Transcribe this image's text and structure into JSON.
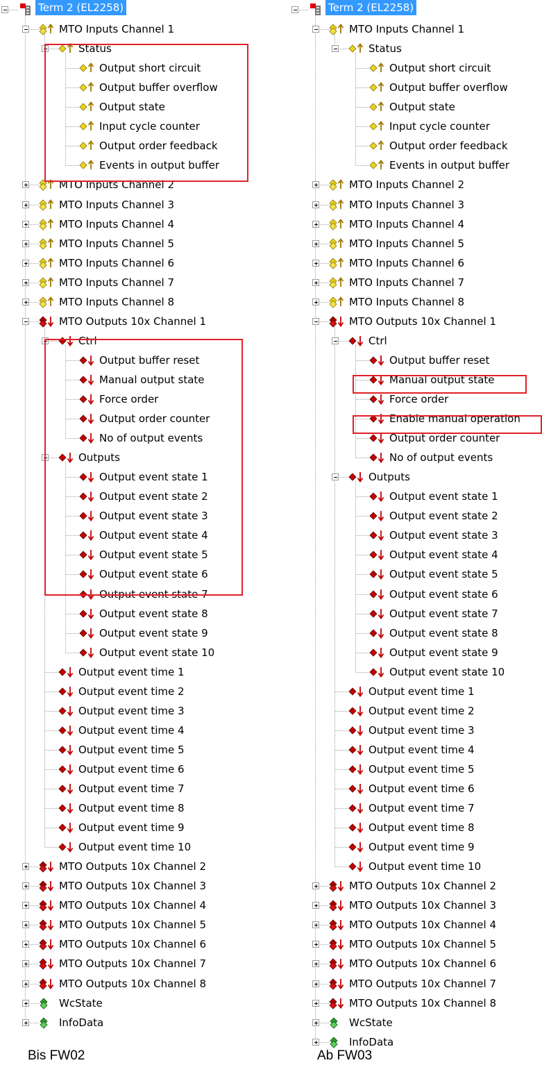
{
  "colors": {
    "highlight_box": "#e0202a",
    "selection": "#3399ff",
    "input_icon": "#e8d31e",
    "output_icon": "#b30000",
    "status_icon": "#2ca02c"
  },
  "left_panel": {
    "caption": "Bis FW02",
    "tree": [
      {
        "label": "Term 2 (EL2258)",
        "level": 0,
        "expander": "minus",
        "icon": "terminal-icon",
        "selected": true
      },
      {
        "label": "MTO Inputs Channel 1",
        "level": 1,
        "expander": "minus",
        "icon": "input-group-icon"
      },
      {
        "label": "Status",
        "level": 2,
        "expander": "minus",
        "icon": "input-var-icon"
      },
      {
        "label": "Output short circuit",
        "level": 3,
        "icon": "input-var-icon"
      },
      {
        "label": "Output buffer overflow",
        "level": 3,
        "icon": "input-var-icon"
      },
      {
        "label": "Output state",
        "level": 3,
        "icon": "input-var-icon"
      },
      {
        "label": "Input cycle counter",
        "level": 3,
        "icon": "input-var-icon"
      },
      {
        "label": "Output order feedback",
        "level": 3,
        "icon": "input-var-icon"
      },
      {
        "label": "Events in output buffer",
        "level": 3,
        "icon": "input-var-icon"
      },
      {
        "label": "MTO Inputs Channel 2",
        "level": 1,
        "expander": "plus",
        "icon": "input-group-icon"
      },
      {
        "label": "MTO Inputs Channel 3",
        "level": 1,
        "expander": "plus",
        "icon": "input-group-icon"
      },
      {
        "label": "MTO Inputs Channel 4",
        "level": 1,
        "expander": "plus",
        "icon": "input-group-icon"
      },
      {
        "label": "MTO Inputs Channel 5",
        "level": 1,
        "expander": "plus",
        "icon": "input-group-icon"
      },
      {
        "label": "MTO Inputs Channel 6",
        "level": 1,
        "expander": "plus",
        "icon": "input-group-icon"
      },
      {
        "label": "MTO Inputs Channel 7",
        "level": 1,
        "expander": "plus",
        "icon": "input-group-icon"
      },
      {
        "label": "MTO Inputs Channel 8",
        "level": 1,
        "expander": "plus",
        "icon": "input-group-icon"
      },
      {
        "label": "MTO Outputs 10x Channel 1",
        "level": 1,
        "expander": "minus",
        "icon": "output-group-icon"
      },
      {
        "label": "Ctrl",
        "level": 2,
        "expander": "minus",
        "icon": "output-var-icon"
      },
      {
        "label": "Output buffer reset",
        "level": 3,
        "icon": "output-var-icon"
      },
      {
        "label": "Manual output state",
        "level": 3,
        "icon": "output-var-icon"
      },
      {
        "label": "Force order",
        "level": 3,
        "icon": "output-var-icon"
      },
      {
        "label": "Output order counter",
        "level": 3,
        "icon": "output-var-icon"
      },
      {
        "label": "No of output events",
        "level": 3,
        "icon": "output-var-icon"
      },
      {
        "label": "Outputs",
        "level": 2,
        "expander": "minus",
        "icon": "output-var-icon"
      },
      {
        "label": "Output event state 1",
        "level": 3,
        "icon": "output-var-icon"
      },
      {
        "label": "Output event state 2",
        "level": 3,
        "icon": "output-var-icon"
      },
      {
        "label": "Output event state 3",
        "level": 3,
        "icon": "output-var-icon"
      },
      {
        "label": "Output event state 4",
        "level": 3,
        "icon": "output-var-icon"
      },
      {
        "label": "Output event state 5",
        "level": 3,
        "icon": "output-var-icon"
      },
      {
        "label": "Output event state 6",
        "level": 3,
        "icon": "output-var-icon"
      },
      {
        "label": "Output event state 7",
        "level": 3,
        "icon": "output-var-icon"
      },
      {
        "label": "Output event state 8",
        "level": 3,
        "icon": "output-var-icon"
      },
      {
        "label": "Output event state 9",
        "level": 3,
        "icon": "output-var-icon"
      },
      {
        "label": "Output event state 10",
        "level": 3,
        "icon": "output-var-icon"
      },
      {
        "label": "Output event time 1",
        "level": 2,
        "icon": "output-var-icon"
      },
      {
        "label": "Output event time 2",
        "level": 2,
        "icon": "output-var-icon"
      },
      {
        "label": "Output event time 3",
        "level": 2,
        "icon": "output-var-icon"
      },
      {
        "label": "Output event time 4",
        "level": 2,
        "icon": "output-var-icon"
      },
      {
        "label": "Output event time 5",
        "level": 2,
        "icon": "output-var-icon"
      },
      {
        "label": "Output event time 6",
        "level": 2,
        "icon": "output-var-icon"
      },
      {
        "label": "Output event time 7",
        "level": 2,
        "icon": "output-var-icon"
      },
      {
        "label": "Output event time 8",
        "level": 2,
        "icon": "output-var-icon"
      },
      {
        "label": "Output event time 9",
        "level": 2,
        "icon": "output-var-icon"
      },
      {
        "label": "Output event time 10",
        "level": 2,
        "icon": "output-var-icon"
      },
      {
        "label": "MTO Outputs 10x Channel 2",
        "level": 1,
        "expander": "plus",
        "icon": "output-group-icon"
      },
      {
        "label": "MTO Outputs 10x Channel 3",
        "level": 1,
        "expander": "plus",
        "icon": "output-group-icon"
      },
      {
        "label": "MTO Outputs 10x Channel 4",
        "level": 1,
        "expander": "plus",
        "icon": "output-group-icon"
      },
      {
        "label": "MTO Outputs 10x Channel 5",
        "level": 1,
        "expander": "plus",
        "icon": "output-group-icon"
      },
      {
        "label": "MTO Outputs 10x Channel 6",
        "level": 1,
        "expander": "plus",
        "icon": "output-group-icon"
      },
      {
        "label": "MTO Outputs 10x Channel 7",
        "level": 1,
        "expander": "plus",
        "icon": "output-group-icon"
      },
      {
        "label": "MTO Outputs 10x Channel 8",
        "level": 1,
        "expander": "plus",
        "icon": "output-group-icon"
      },
      {
        "label": "WcState",
        "level": 1,
        "expander": "plus",
        "icon": "status-icon"
      },
      {
        "label": "InfoData",
        "level": 1,
        "expander": "plus",
        "icon": "status-icon"
      }
    ]
  },
  "right_panel": {
    "caption": "Ab FW03",
    "tree": [
      {
        "label": "Term 2 (EL2258)",
        "level": 0,
        "expander": "minus",
        "icon": "terminal-icon",
        "selected": true
      },
      {
        "label": "MTO Inputs Channel 1",
        "level": 1,
        "expander": "minus",
        "icon": "input-group-icon"
      },
      {
        "label": "Status",
        "level": 2,
        "expander": "minus",
        "icon": "input-var-icon"
      },
      {
        "label": "Output short circuit",
        "level": 3,
        "icon": "input-var-icon"
      },
      {
        "label": "Output buffer overflow",
        "level": 3,
        "icon": "input-var-icon"
      },
      {
        "label": "Output state",
        "level": 3,
        "icon": "input-var-icon"
      },
      {
        "label": "Input cycle counter",
        "level": 3,
        "icon": "input-var-icon"
      },
      {
        "label": "Output order feedback",
        "level": 3,
        "icon": "input-var-icon"
      },
      {
        "label": "Events in output buffer",
        "level": 3,
        "icon": "input-var-icon"
      },
      {
        "label": "MTO Inputs Channel 2",
        "level": 1,
        "expander": "plus",
        "icon": "input-group-icon"
      },
      {
        "label": "MTO Inputs Channel 3",
        "level": 1,
        "expander": "plus",
        "icon": "input-group-icon"
      },
      {
        "label": "MTO Inputs Channel 4",
        "level": 1,
        "expander": "plus",
        "icon": "input-group-icon"
      },
      {
        "label": "MTO Inputs Channel 5",
        "level": 1,
        "expander": "plus",
        "icon": "input-group-icon"
      },
      {
        "label": "MTO Inputs Channel 6",
        "level": 1,
        "expander": "plus",
        "icon": "input-group-icon"
      },
      {
        "label": "MTO Inputs Channel 7",
        "level": 1,
        "expander": "plus",
        "icon": "input-group-icon"
      },
      {
        "label": "MTO Inputs Channel 8",
        "level": 1,
        "expander": "plus",
        "icon": "input-group-icon"
      },
      {
        "label": "MTO Outputs 10x Channel 1",
        "level": 1,
        "expander": "minus",
        "icon": "output-group-icon"
      },
      {
        "label": "Ctrl",
        "level": 2,
        "expander": "minus",
        "icon": "output-var-icon"
      },
      {
        "label": "Output buffer reset",
        "level": 3,
        "icon": "output-var-icon"
      },
      {
        "label": "Manual output state",
        "level": 3,
        "icon": "output-var-icon"
      },
      {
        "label": "Force order",
        "level": 3,
        "icon": "output-var-icon"
      },
      {
        "label": "Enable manual operation",
        "level": 3,
        "icon": "output-var-icon"
      },
      {
        "label": "Output order counter",
        "level": 3,
        "icon": "output-var-icon"
      },
      {
        "label": "No of output events",
        "level": 3,
        "icon": "output-var-icon"
      },
      {
        "label": "Outputs",
        "level": 2,
        "expander": "minus",
        "icon": "output-var-icon"
      },
      {
        "label": "Output event state 1",
        "level": 3,
        "icon": "output-var-icon"
      },
      {
        "label": "Output event state 2",
        "level": 3,
        "icon": "output-var-icon"
      },
      {
        "label": "Output event state 3",
        "level": 3,
        "icon": "output-var-icon"
      },
      {
        "label": "Output event state 4",
        "level": 3,
        "icon": "output-var-icon"
      },
      {
        "label": "Output event state 5",
        "level": 3,
        "icon": "output-var-icon"
      },
      {
        "label": "Output event state 6",
        "level": 3,
        "icon": "output-var-icon"
      },
      {
        "label": "Output event state 7",
        "level": 3,
        "icon": "output-var-icon"
      },
      {
        "label": "Output event state 8",
        "level": 3,
        "icon": "output-var-icon"
      },
      {
        "label": "Output event state 9",
        "level": 3,
        "icon": "output-var-icon"
      },
      {
        "label": "Output event state 10",
        "level": 3,
        "icon": "output-var-icon"
      },
      {
        "label": "Output event time 1",
        "level": 2,
        "icon": "output-var-icon"
      },
      {
        "label": "Output event time 2",
        "level": 2,
        "icon": "output-var-icon"
      },
      {
        "label": "Output event time 3",
        "level": 2,
        "icon": "output-var-icon"
      },
      {
        "label": "Output event time 4",
        "level": 2,
        "icon": "output-var-icon"
      },
      {
        "label": "Output event time 5",
        "level": 2,
        "icon": "output-var-icon"
      },
      {
        "label": "Output event time 6",
        "level": 2,
        "icon": "output-var-icon"
      },
      {
        "label": "Output event time 7",
        "level": 2,
        "icon": "output-var-icon"
      },
      {
        "label": "Output event time 8",
        "level": 2,
        "icon": "output-var-icon"
      },
      {
        "label": "Output event time 9",
        "level": 2,
        "icon": "output-var-icon"
      },
      {
        "label": "Output event time 10",
        "level": 2,
        "icon": "output-var-icon"
      },
      {
        "label": "MTO Outputs 10x Channel 2",
        "level": 1,
        "expander": "plus",
        "icon": "output-group-icon"
      },
      {
        "label": "MTO Outputs 10x Channel 3",
        "level": 1,
        "expander": "plus",
        "icon": "output-group-icon"
      },
      {
        "label": "MTO Outputs 10x Channel 4",
        "level": 1,
        "expander": "plus",
        "icon": "output-group-icon"
      },
      {
        "label": "MTO Outputs 10x Channel 5",
        "level": 1,
        "expander": "plus",
        "icon": "output-group-icon"
      },
      {
        "label": "MTO Outputs 10x Channel 6",
        "level": 1,
        "expander": "plus",
        "icon": "output-group-icon"
      },
      {
        "label": "MTO Outputs 10x Channel 7",
        "level": 1,
        "expander": "plus",
        "icon": "output-group-icon"
      },
      {
        "label": "MTO Outputs 10x Channel 8",
        "level": 1,
        "expander": "plus",
        "icon": "output-group-icon"
      },
      {
        "label": "WcState",
        "level": 1,
        "expander": "plus",
        "icon": "status-icon"
      },
      {
        "label": "InfoData",
        "level": 1,
        "expander": "plus",
        "icon": "status-icon"
      }
    ]
  }
}
